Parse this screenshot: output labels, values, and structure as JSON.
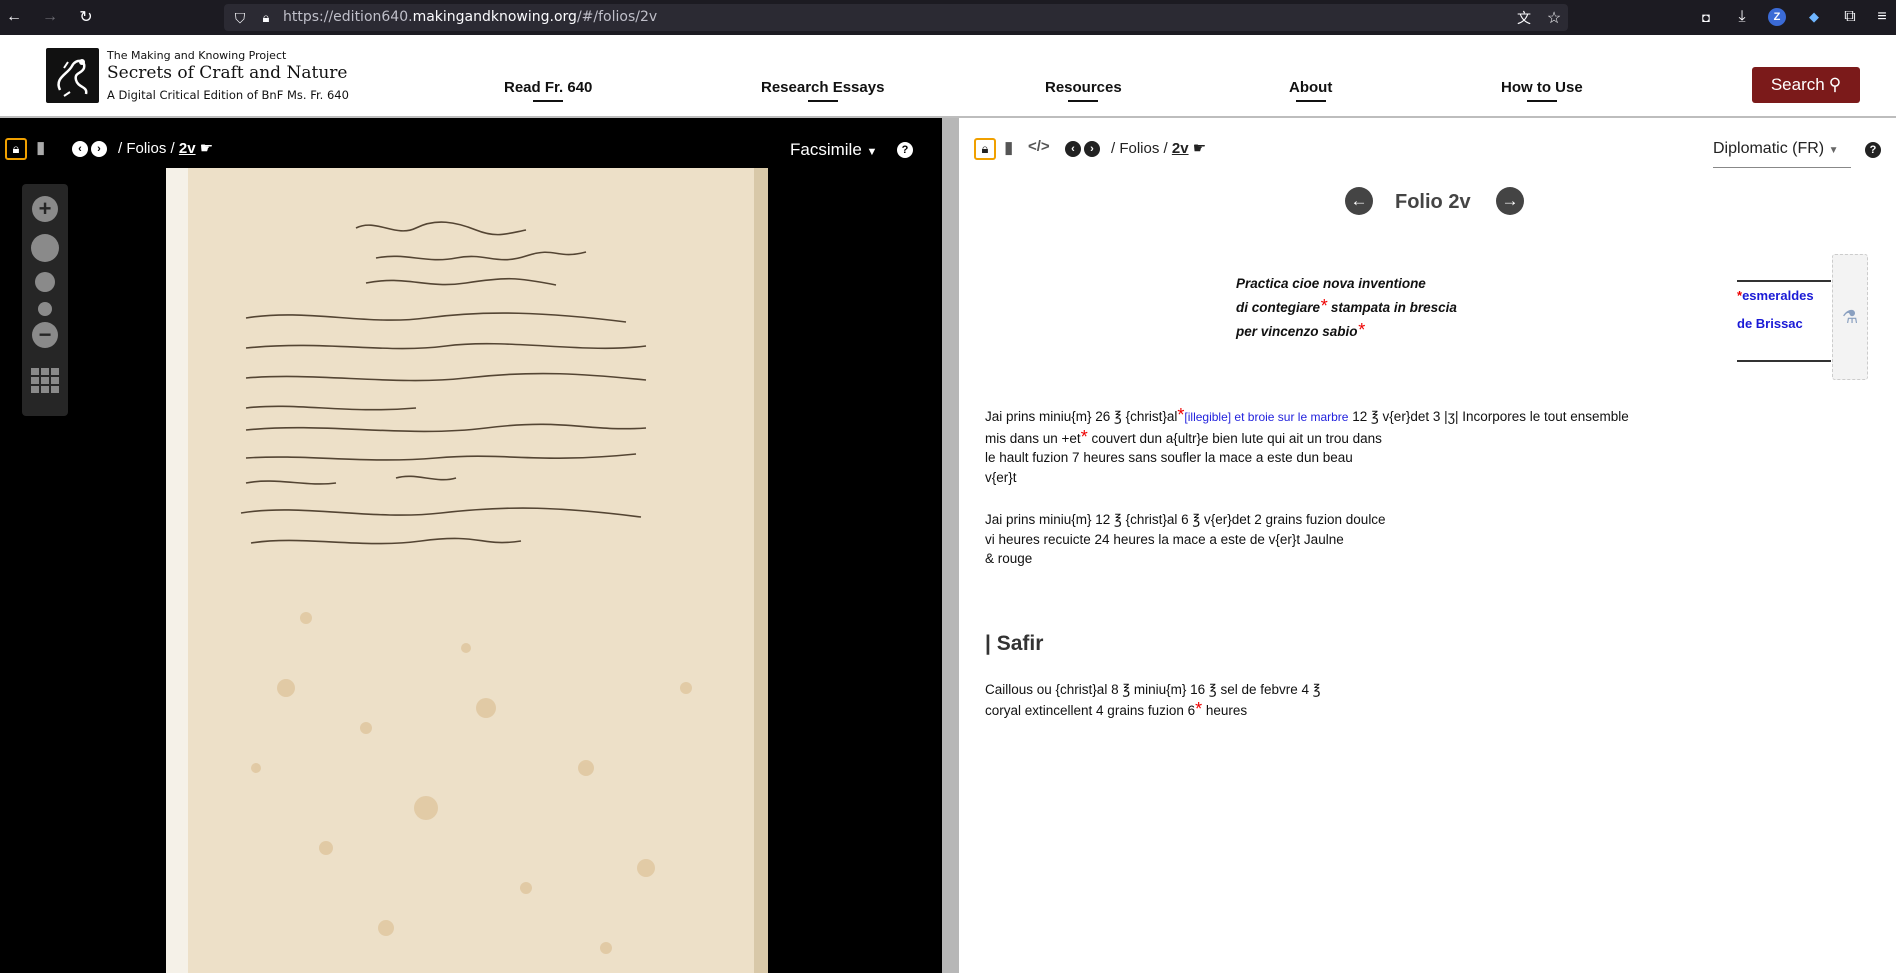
{
  "browser": {
    "url_prefix": "https://edition640.",
    "url_domain": "makingandknowing.org",
    "url_suffix": "/#/folios/2v"
  },
  "site": {
    "project": "The Making and Knowing Project",
    "title": "Secrets of Craft and Nature",
    "subtitle": "A Digital Critical Edition of BnF Ms. Fr. 640",
    "nav": [
      "Read Fr. 640",
      "Research Essays",
      "Resources",
      "About",
      "How to Use"
    ],
    "search_label": "Search"
  },
  "left": {
    "folios": "/ Folios /",
    "folio": "2v",
    "view": "Facsimile",
    "help": "?"
  },
  "right": {
    "folios": "/ Folios /",
    "folio": "2v",
    "view": "Diplomatic (FR)",
    "help": "?",
    "folio_title": "Folio 2v",
    "heading": {
      "line1": "Practica cioe nova inventione",
      "line2": "di contegiare",
      "line2b": "stampata in brescia",
      "line3": "per vincenzo sabio"
    },
    "margin_note": {
      "line1": "esmeraldes",
      "line2": "de Brissac"
    },
    "asterisk": "*",
    "para1": {
      "a": "Jai prins miniu{m} 26 ℥ {christ}al",
      "illegible": "[illegible] et broie sur le marbre",
      "b": " 12 ℥ v{er}det 3 |ʒ| Incorpores le tout ensemble",
      "c": "mis dans un +et",
      "d": " couvert dun a{ultr}e bien lute qui ait un trou dans",
      "e": "le hault fuzion 7 heures sans soufler la mace a este dun beau",
      "f": "v{er}t"
    },
    "para2": {
      "a": "Jai prins miniu{m} 12 ℥ {christ}al 6 ℥ v{er}det 2 grains fuzion doulce",
      "b": "vi heures recuicte 24 heures la mace a este de v{er}t Jaulne",
      "c": "& rouge"
    },
    "section_title": "| Safir",
    "para3": {
      "a": "Caillous ou {christ}al 8 ℥ miniu{m} 16 ℥ sel de febvre 4 ℥",
      "b": "coryal extincellent 4 grains fuzion 6",
      "c": " heures"
    }
  },
  "colors": {
    "search_bg": "#7b1a1a",
    "lock_accent": "#f0a000",
    "asterisk": "#e00000",
    "link_blue": "#1a1ad6"
  }
}
